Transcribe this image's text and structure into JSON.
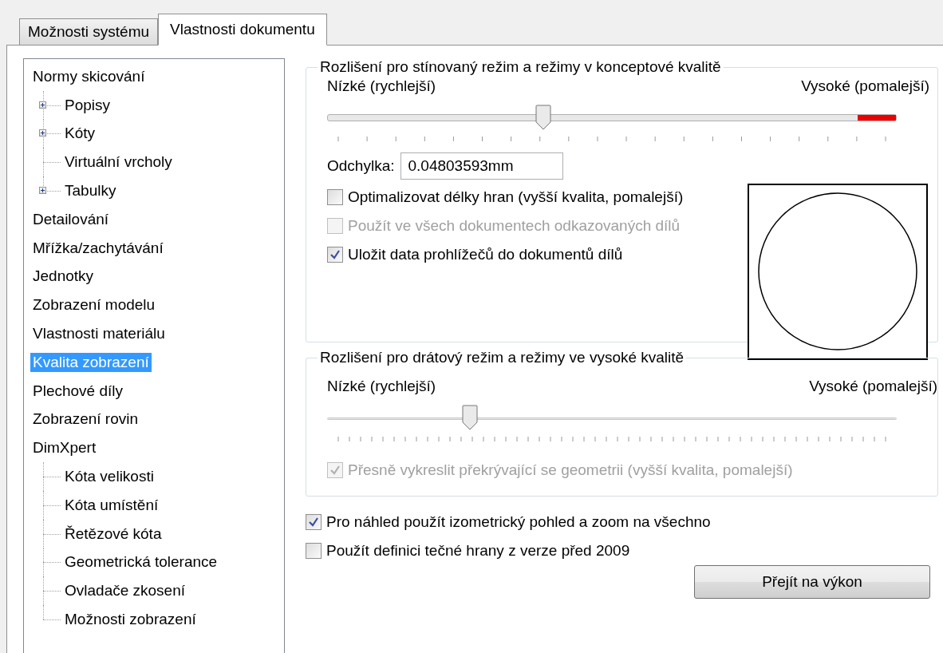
{
  "tabs": [
    {
      "label": "Možnosti systému",
      "selected": false
    },
    {
      "label": "Vlastnosti dokumentu",
      "selected": true
    }
  ],
  "tree": [
    {
      "label": "Normy skicování",
      "selected": false,
      "children": [
        {
          "label": "Popisy",
          "expandable": true,
          "selected": false
        },
        {
          "label": "Kóty",
          "expandable": true,
          "selected": false
        },
        {
          "label": "Virtuální vrcholy",
          "expandable": false,
          "selected": false
        },
        {
          "label": "Tabulky",
          "expandable": true,
          "selected": false
        }
      ]
    },
    {
      "label": "Detailování",
      "selected": false
    },
    {
      "label": "Mřížka/zachytávání",
      "selected": false
    },
    {
      "label": "Jednotky",
      "selected": false
    },
    {
      "label": "Zobrazení modelu",
      "selected": false
    },
    {
      "label": "Vlastnosti materiálu",
      "selected": false
    },
    {
      "label": "Kvalita zobrazení",
      "selected": true
    },
    {
      "label": "Plechové díly",
      "selected": false
    },
    {
      "label": "Zobrazení rovin",
      "selected": false
    },
    {
      "label": "DimXpert",
      "selected": false,
      "children": [
        {
          "label": "Kóta velikosti",
          "expandable": false,
          "selected": false
        },
        {
          "label": "Kóta umístění",
          "expandable": false,
          "selected": false
        },
        {
          "label": "Řetězové kóta",
          "expandable": false,
          "selected": false
        },
        {
          "label": "Geometrická tolerance",
          "expandable": false,
          "selected": false
        },
        {
          "label": "Ovladače zkosení",
          "expandable": false,
          "selected": false
        },
        {
          "label": "Možnosti zobrazení",
          "expandable": false,
          "selected": false
        }
      ]
    }
  ],
  "shaded_group": {
    "title": "Rozlišení pro stínovaný režim a režimy v konceptové kvalitě",
    "low_label": "Nízké (rychlejší)",
    "high_label": "Vysoké (pomalejší)",
    "slider": {
      "level": 0.38,
      "red_range": true
    },
    "deviation": {
      "label": "Odchylka:",
      "value": "0.04803593mm"
    },
    "checkboxes": [
      {
        "label": "Optimalizovat délky hran (vyšší kvalita, pomalejší)",
        "checked": false,
        "disabled": false
      },
      {
        "label": "Použít ve všech dokumentech odkazovaných dílů",
        "checked": false,
        "disabled": true
      },
      {
        "label": "Uložit data prohlížečů do dokumentů dílů",
        "checked": true,
        "disabled": false
      }
    ]
  },
  "wire_group": {
    "title": "Rozlišení pro drátový režim a režimy ve vysoké kvalitě",
    "low_label": "Nízké (rychlejší)",
    "high_label": "Vysoké (pomalejší)",
    "slider": {
      "level": 0.25,
      "red_range": false
    },
    "checkboxes": [
      {
        "label": "Přesně vykreslit překrývající se geometrii (vyšší kvalita, pomalejší)",
        "checked": true,
        "disabled": true
      }
    ]
  },
  "options": [
    {
      "label": "Pro náhled použít izometrický pohled a zoom na všechno",
      "checked": true,
      "disabled": false
    },
    {
      "label": "Použít definici tečné hrany z verze před 2009",
      "checked": false,
      "disabled": false
    }
  ],
  "button": "Přejít na výkon"
}
